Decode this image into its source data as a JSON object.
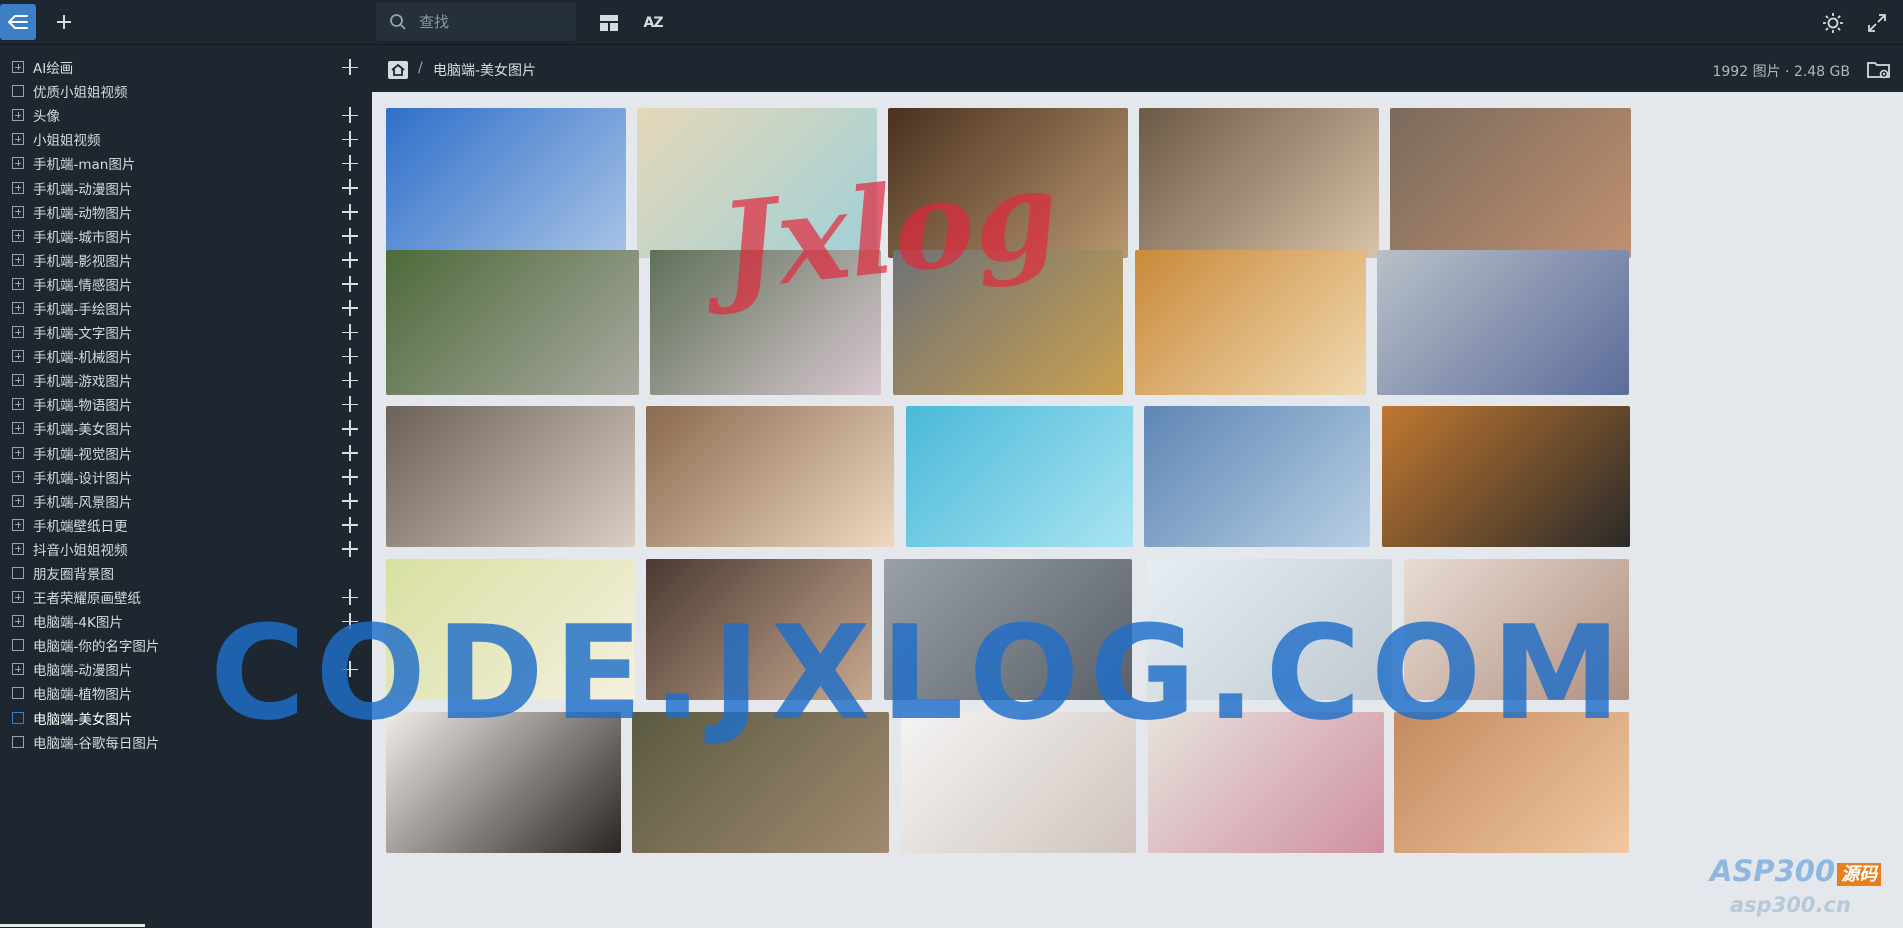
{
  "header": {
    "search_placeholder": "查找",
    "sort_label": "AZ"
  },
  "sidebar": {
    "items": [
      {
        "label": "AI绘画",
        "expandable": true,
        "addable": true
      },
      {
        "label": "优质小姐姐视频",
        "expandable": false,
        "addable": false
      },
      {
        "label": "头像",
        "expandable": true,
        "addable": true
      },
      {
        "label": "小姐姐视频",
        "expandable": true,
        "addable": true
      },
      {
        "label": "手机端-man图片",
        "expandable": true,
        "addable": true
      },
      {
        "label": "手机端-动漫图片",
        "expandable": true,
        "addable": true
      },
      {
        "label": "手机端-动物图片",
        "expandable": true,
        "addable": true
      },
      {
        "label": "手机端-城市图片",
        "expandable": true,
        "addable": true
      },
      {
        "label": "手机端-影视图片",
        "expandable": true,
        "addable": true
      },
      {
        "label": "手机端-情感图片",
        "expandable": true,
        "addable": true
      },
      {
        "label": "手机端-手绘图片",
        "expandable": true,
        "addable": true
      },
      {
        "label": "手机端-文字图片",
        "expandable": true,
        "addable": true
      },
      {
        "label": "手机端-机械图片",
        "expandable": true,
        "addable": true
      },
      {
        "label": "手机端-游戏图片",
        "expandable": true,
        "addable": true
      },
      {
        "label": "手机端-物语图片",
        "expandable": true,
        "addable": true
      },
      {
        "label": "手机端-美女图片",
        "expandable": true,
        "addable": true
      },
      {
        "label": "手机端-视觉图片",
        "expandable": true,
        "addable": true
      },
      {
        "label": "手机端-设计图片",
        "expandable": true,
        "addable": true
      },
      {
        "label": "手机端-风景图片",
        "expandable": true,
        "addable": true
      },
      {
        "label": "手机端壁纸日更",
        "expandable": true,
        "addable": true
      },
      {
        "label": "抖音小姐姐视频",
        "expandable": true,
        "addable": true
      },
      {
        "label": "朋友圈背景图",
        "expandable": false,
        "addable": false
      },
      {
        "label": "王者荣耀原画壁纸",
        "expandable": true,
        "addable": true
      },
      {
        "label": "电脑端-4K图片",
        "expandable": true,
        "addable": true
      },
      {
        "label": "电脑端-你的名字图片",
        "expandable": false,
        "addable": false
      },
      {
        "label": "电脑端-动漫图片",
        "expandable": true,
        "addable": true
      },
      {
        "label": "电脑端-植物图片",
        "expandable": false,
        "addable": false
      },
      {
        "label": "电脑端-美女图片",
        "expandable": false,
        "addable": false,
        "active": true
      },
      {
        "label": "电脑端-谷歌每日图片",
        "expandable": false,
        "addable": false
      }
    ]
  },
  "breadcrumb": {
    "separator": "/",
    "current": "电脑端-美女图片",
    "stats": "1992 图片 · 2.48 GB"
  },
  "gallery": {
    "thumbnails": [
      {
        "row": 1,
        "colors": [
          "#2f6fc9",
          "#a8c4e6"
        ]
      },
      {
        "row": 1,
        "colors": [
          "#e6d7b8",
          "#9fd0d8"
        ]
      },
      {
        "row": 1,
        "colors": [
          "#4a3020",
          "#b89870"
        ]
      },
      {
        "row": 1,
        "colors": [
          "#6b5a46",
          "#d8c2a8"
        ]
      },
      {
        "row": 1,
        "colors": [
          "#7a6a5c",
          "#c09070"
        ]
      },
      {
        "row": 2,
        "colors": [
          "#4d6a3a",
          "#a9a9a0"
        ]
      },
      {
        "row": 2,
        "colors": [
          "#5f7058",
          "#d8c8d0"
        ]
      },
      {
        "row": 2,
        "colors": [
          "#6f7276",
          "#c9a050"
        ]
      },
      {
        "row": 2,
        "colors": [
          "#c98a3a",
          "#f1d8b0"
        ]
      },
      {
        "row": 2,
        "colors": [
          "#b8c0c8",
          "#5c6c9a"
        ]
      },
      {
        "row": 3,
        "colors": [
          "#6c6058",
          "#d9cfc2"
        ]
      },
      {
        "row": 3,
        "colors": [
          "#8a6a50",
          "#eed8c0"
        ]
      },
      {
        "row": 3,
        "colors": [
          "#4ab9d9",
          "#a9e4f2"
        ]
      },
      {
        "row": 3,
        "colors": [
          "#5e86b4",
          "#b8cfe4"
        ]
      },
      {
        "row": 3,
        "colors": [
          "#c07830",
          "#2a2a2a"
        ]
      },
      {
        "row": 4,
        "colors": [
          "#d8e0a0",
          "#f4f0e0"
        ]
      },
      {
        "row": 4,
        "colors": [
          "#4a3a32",
          "#c8a890"
        ]
      },
      {
        "row": 4,
        "colors": [
          "#9aa0a8",
          "#5a6068"
        ]
      },
      {
        "row": 4,
        "colors": [
          "#e6eef4",
          "#c0c8d0"
        ]
      },
      {
        "row": 4,
        "colors": [
          "#e8dcd4",
          "#b09080"
        ]
      },
      {
        "row": 5,
        "colors": [
          "#f0ece8",
          "#2a2624"
        ]
      },
      {
        "row": 5,
        "colors": [
          "#5a5a40",
          "#a08a70"
        ]
      },
      {
        "row": 5,
        "colors": [
          "#f4f4f4",
          "#d0c4bc"
        ]
      },
      {
        "row": 5,
        "colors": [
          "#e6e2dc",
          "#d090a0"
        ]
      },
      {
        "row": 5,
        "colors": [
          "#c48a60",
          "#f0c8a0"
        ]
      }
    ]
  },
  "watermarks": {
    "center": "CODE.JXLOG.COM",
    "top_script": "Jxlog",
    "corner_brand": "ASP300",
    "corner_tag": "源码",
    "corner_url": "asp300.cn"
  },
  "colors": {
    "background": "#1e2730",
    "accent": "#3d7fc4",
    "gallery_bg": "#e4e8ec"
  }
}
